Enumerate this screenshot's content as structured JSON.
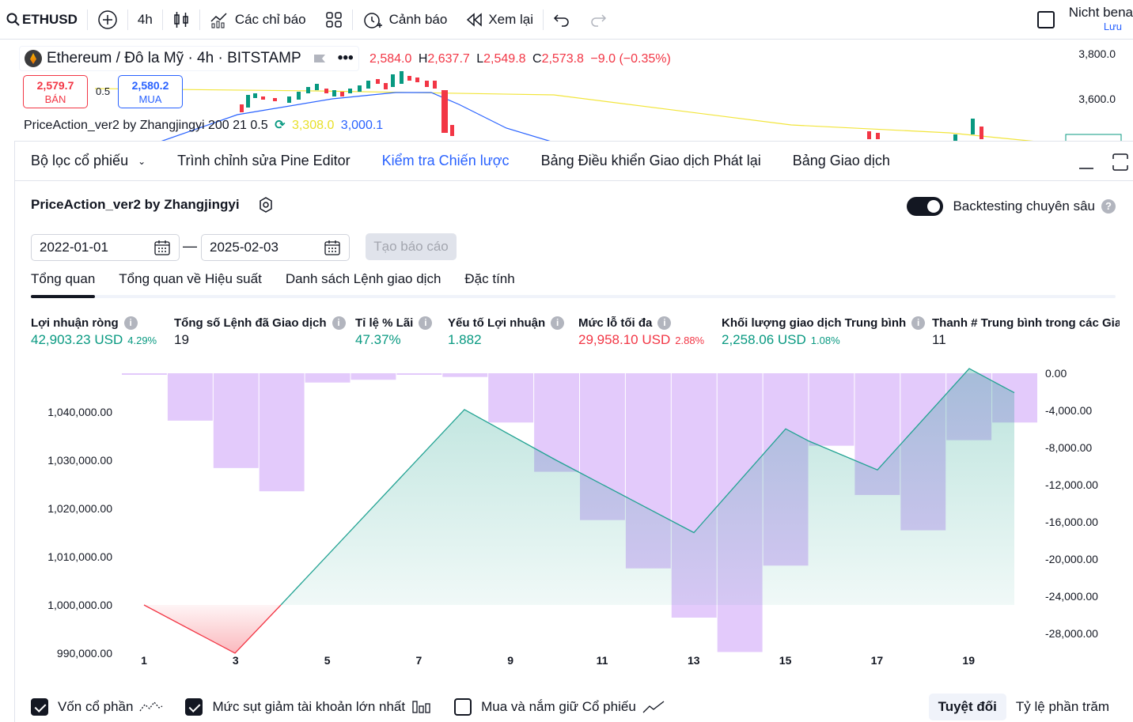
{
  "toolbar": {
    "symbol": "ETHUSD",
    "interval": "4h",
    "indicators": "Các chỉ báo",
    "alerts": "Cảnh báo",
    "replay": "Xem lại",
    "right_title": "Nicht bena",
    "right_sub": "Lưu"
  },
  "chart": {
    "title": "Ethereum / Đô la Mỹ · 4h · BITSTAMP",
    "ohlc": {
      "o_label": "",
      "o": "2,584.0",
      "h_label": "H",
      "h": "2,637.7",
      "l_label": "L",
      "l": "2,549.8",
      "c_label": "C",
      "c": "2,573.8",
      "change": "−9.0 (−0.35%)"
    },
    "sell_price": "2,579.7",
    "sell_label": "BÁN",
    "buy_price": "2,580.2",
    "buy_label": "MUA",
    "spread": "0.5",
    "indicator": "PriceAction_ver2 by Zhangjingyi 200 21 0.5",
    "ind_val1": "3,308.0",
    "ind_val2": "3,000.1",
    "axis_prices": [
      "3,800.0",
      "3,600.0"
    ]
  },
  "panel": {
    "tabs": [
      "Bộ lọc cổ phiếu",
      "Trình chỉnh sửa Pine Editor",
      "Kiểm tra Chiến lược",
      "Bảng Điều khiển Giao dịch Phát lại",
      "Bảng Giao dịch"
    ],
    "active_tab": 2,
    "strategy_name": "PriceAction_ver2 by Zhangjingyi",
    "deep_backtest": "Backtesting chuyên sâu",
    "date_from": "2022-01-01",
    "date_to": "2025-02-03",
    "report_button": "Tạo báo cáo",
    "subtabs": [
      "Tổng quan",
      "Tổng quan về Hiệu suất",
      "Danh sách Lệnh giao dịch",
      "Đặc tính"
    ],
    "metrics": [
      {
        "label": "Lợi nhuận ròng",
        "value": "42,903.23 USD",
        "pct": "4.29%",
        "color": "green"
      },
      {
        "label": "Tổng số Lệnh đã Giao dịch",
        "value": "19",
        "pct": "",
        "color": "dark"
      },
      {
        "label": "Tỉ lệ % Lãi",
        "value": "47.37%",
        "pct": "",
        "color": "green"
      },
      {
        "label": "Yếu tố Lợi nhuận",
        "value": "1.882",
        "pct": "",
        "color": "green"
      },
      {
        "label": "Mức lỗ tối đa",
        "value": "29,958.10 USD",
        "pct": "2.88%",
        "color": "red"
      },
      {
        "label": "Khối lượng giao dịch Trung bình",
        "value": "2,258.06 USD",
        "pct": "1.08%",
        "color": "green"
      },
      {
        "label": "Thanh # Trung bình trong các Giao dịch",
        "value": "11",
        "pct": "",
        "color": "dark"
      }
    ],
    "footer": {
      "equity": "Vốn cổ phần",
      "drawdown": "Mức sụt giảm tài khoản lớn nhất",
      "buyhold": "Mua và nắm giữ Cổ phiếu",
      "absolute": "Tuyệt đối",
      "percent": "Tỷ lệ phần trăm"
    }
  },
  "chart_data": {
    "type": "line",
    "x_ticks": [
      "1",
      "3",
      "5",
      "7",
      "9",
      "11",
      "13",
      "15",
      "17",
      "19"
    ],
    "left_axis": {
      "ticks": [
        "1,040,000.00",
        "1,030,000.00",
        "1,020,000.00",
        "1,010,000.00",
        "1,000,000.00",
        "990,000.00"
      ],
      "range": [
        985000,
        1045000
      ]
    },
    "right_axis": {
      "ticks": [
        "0.00",
        "-4,000.00",
        "-8,000.00",
        "-12,000.00",
        "-16,000.00",
        "-20,000.00",
        "-24,000.00",
        "-28,000.00"
      ],
      "range": [
        -30000,
        1000
      ]
    },
    "equity": {
      "name": "Vốn cổ phần",
      "x": [
        1,
        3,
        4,
        8,
        10,
        11,
        13,
        15,
        16,
        17,
        19,
        20
      ],
      "y": [
        1000000,
        990000,
        1000000,
        1040500,
        1030000,
        1027500,
        1015000,
        1036500,
        1034000,
        1028000,
        1049000,
        1044000
      ]
    },
    "drawdown": {
      "name": "Mức sụt giảm tài khoản lớn nhất",
      "x": [
        1,
        2,
        3,
        4,
        5,
        6,
        7,
        8,
        9,
        10,
        11,
        12,
        13,
        14,
        15,
        16,
        17,
        18,
        19,
        20
      ],
      "y": [
        0,
        -5100,
        -10200,
        -12700,
        -1000,
        -700,
        -100,
        -400,
        -5300,
        -10600,
        -15800,
        -21000,
        -26300,
        -30000,
        -20700,
        -7800,
        -13100,
        -16900,
        -7200,
        -5300
      ]
    }
  }
}
